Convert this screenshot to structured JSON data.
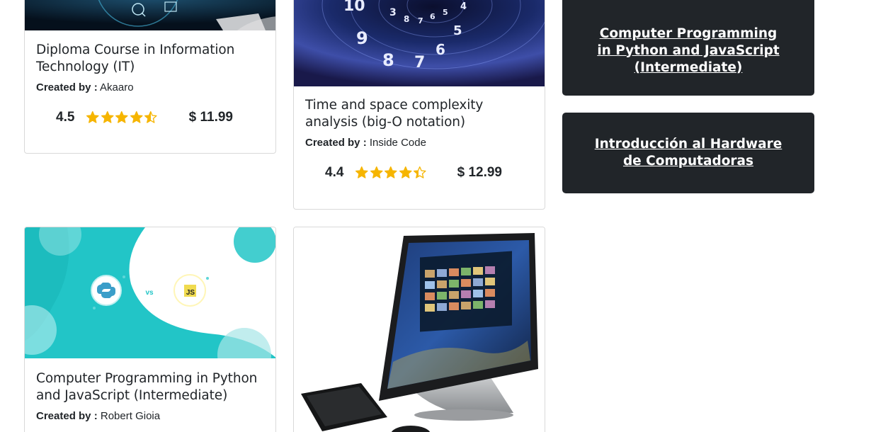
{
  "courses": [
    {
      "title": "Diploma Course in Information Technology (IT)",
      "created_label": "Created by :",
      "author": "Akaaro",
      "rating": "4.5",
      "stars": 4.5,
      "price": "$ 11.99"
    },
    {
      "title": "Time and space complexity analysis (big-O notation)",
      "created_label": "Created by :",
      "author": "Inside Code",
      "rating": "4.4",
      "stars": 4.4,
      "price": "$ 12.99"
    },
    {
      "title": "Computer Programming in Python and JavaScript (Intermediate)",
      "created_label": "Created by :",
      "author": "Robert Gioia"
    },
    {
      "title": ""
    }
  ],
  "thumbnail_text": {
    "vs": "vs",
    "js": "JS"
  },
  "sidebar": {
    "links": [
      {
        "label": "Computer Programming in Python and JavaScript (Intermediate)"
      },
      {
        "label": "Introducción al Hardware de Computadoras"
      }
    ]
  },
  "colors": {
    "star": "#f6b500",
    "sidebar_bg": "#212529",
    "teal": "#1fc9c9"
  }
}
